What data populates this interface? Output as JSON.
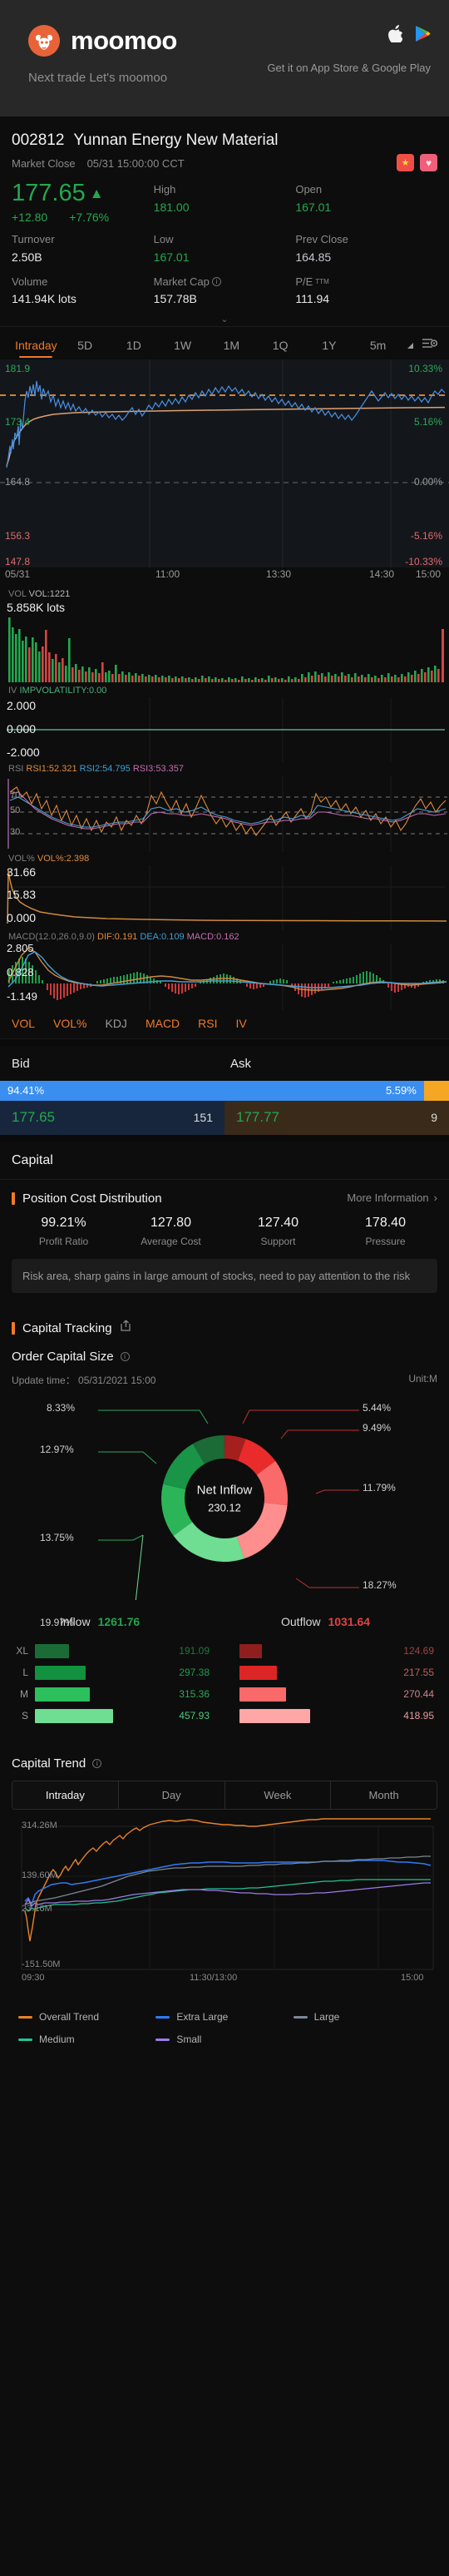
{
  "promo": {
    "wordmark": "moomoo",
    "tagline": "Next trade Let's moomoo",
    "store_caption": "Get it on App Store & Google Play",
    "apple_icon": "apple-icon",
    "google_play_icon": "google-play-icon"
  },
  "quote": {
    "symbol": "002812",
    "name": "Yunnan Energy New Material",
    "market_status": "Market Close",
    "timestamp": "05/31 15:00:00 CCT",
    "flag_badge": "cn-flag-icon",
    "watch_badge": "heart-icon",
    "last_price": "177.65",
    "arrow": "▲",
    "change": "+12.80",
    "change_pct": "+7.76%",
    "stats": [
      {
        "label": "Turnover",
        "value": "2.50B",
        "tone": "plain"
      },
      {
        "label": "High",
        "value": "181.00",
        "tone": "up"
      },
      {
        "label": "Open",
        "value": "167.01",
        "tone": "up"
      },
      {
        "label": "Low",
        "value": "167.01",
        "tone": "up"
      },
      {
        "label": "Prev Close",
        "value": "164.85",
        "tone": "neutral"
      },
      {
        "label": "Volume",
        "value": "141.94K lots",
        "tone": "plain"
      },
      {
        "label": "Market Cap",
        "value": "157.78B",
        "tone": "plain"
      },
      {
        "label": "P/E",
        "value": "111.94",
        "tone": "plain"
      }
    ],
    "expand_icon": "chevron-down-icon"
  },
  "timeframes": {
    "tabs": [
      "Intraday",
      "5D",
      "1D",
      "1W",
      "1M",
      "1Q",
      "1Y",
      "5m"
    ],
    "active": "Intraday",
    "settings_icon": "chart-settings-icon",
    "expand_icon": "triangle-expand-icon"
  },
  "price_chart": {
    "y_top": "181.9",
    "y_upper": "173.4",
    "y_mid": "164.8",
    "y_lower": "156.3",
    "y_bottom": "147.8",
    "p_top": "10.33%",
    "p_upper": "5.16%",
    "p_mid": "0.00%",
    "p_lower": "-5.16%",
    "p_bottom": "-10.33%",
    "x_ticks": [
      "05/31",
      "11:00",
      "13:30",
      "14:30",
      "15:00"
    ]
  },
  "indicators": {
    "vol": {
      "name": "VOL",
      "reading": "VOL:1221",
      "peak": "5.858K lots"
    },
    "iv": {
      "name": "IV",
      "reading": "IMPVOLATILITY:0.00",
      "y": [
        "2.000",
        "0.000",
        "-2.000"
      ]
    },
    "rsi": {
      "name": "RSI",
      "r1": "RSI1:52.321",
      "r2": "RSI2:54.795",
      "r3": "RSI3:53.357",
      "levels": [
        "70",
        "50",
        "30"
      ]
    },
    "volpct": {
      "name": "VOL%",
      "reading": "VOL%:2.398",
      "y": [
        "31.66",
        "15.83",
        "0.000"
      ]
    },
    "macd": {
      "name": "MACD(12.0,26.0,9.0)",
      "dif": "DIF:0.191",
      "dea": "DEA:0.109",
      "macd": "MACD:0.162",
      "y": [
        "2.805",
        "0.828",
        "-1.149"
      ]
    },
    "tabs": [
      "VOL",
      "VOL%",
      "KDJ",
      "MACD",
      "RSI",
      "IV"
    ],
    "inactive_tab": "KDJ"
  },
  "order_book": {
    "bid_label": "Bid",
    "ask_label": "Ask",
    "bid_pct": "94.41%",
    "ask_pct": "5.59%",
    "bid_price": "177.65",
    "bid_qty": "151",
    "ask_price": "177.77",
    "ask_qty": "9"
  },
  "capital": {
    "section_title": "Capital",
    "pcd": {
      "title": "Position Cost Distribution",
      "more": "More Information",
      "more_icon": "chevron-right-icon",
      "metrics": [
        {
          "value": "99.21%",
          "label": "Profit Ratio"
        },
        {
          "value": "127.80",
          "label": "Average Cost"
        },
        {
          "value": "127.40",
          "label": "Support"
        },
        {
          "value": "178.40",
          "label": "Pressure"
        }
      ],
      "note": "Risk area, sharp gains in large amount of stocks, need to pay attention to the risk"
    },
    "tracking": {
      "title": "Capital Tracking",
      "share_icon": "share-icon",
      "order_size_title": "Order Capital Size",
      "info_icon": "info-icon",
      "update_time": "Update time： 05/31/2021 15:00",
      "unit": "Unit:M"
    }
  },
  "chart_data": [
    {
      "type": "pie",
      "title": "Net Inflow",
      "center_value": "230.12",
      "labels": [
        "8.33%",
        "12.97%",
        "13.75%",
        "19.97%",
        "18.27%",
        "11.79%",
        "9.49%",
        "5.44%"
      ],
      "slices": [
        {
          "label": "8.33%",
          "value": 8.33,
          "color": "#1b6b36"
        },
        {
          "label": "12.97%",
          "value": 12.97,
          "color": "#1a9447"
        },
        {
          "label": "13.75%",
          "value": 13.75,
          "color": "#2cb558"
        },
        {
          "label": "19.97%",
          "value": 19.97,
          "color": "#6fdd92"
        },
        {
          "label": "18.27%",
          "value": 18.27,
          "color": "#ff8e8e"
        },
        {
          "label": "11.79%",
          "value": 11.79,
          "color": "#fb6a6a"
        },
        {
          "label": "9.49%",
          "value": 9.49,
          "color": "#ea2b2b"
        },
        {
          "label": "5.44%",
          "value": 5.44,
          "color": "#a51f1f"
        }
      ]
    },
    {
      "type": "bar",
      "title": "Inflow / Outflow",
      "categories": [
        "XL",
        "L",
        "M",
        "S"
      ],
      "inflow_label": "Inflow",
      "inflow_total": "1261.76",
      "outflow_label": "Outflow",
      "outflow_total": "1031.64",
      "series": [
        {
          "name": "Inflow",
          "values": [
            191.09,
            297.38,
            315.36,
            457.93
          ],
          "display": [
            "191.09",
            "297.38",
            "315.36",
            "457.93"
          ],
          "colors": [
            "#1b6b36",
            "#12913f",
            "#2cc05c",
            "#6fdd92"
          ]
        },
        {
          "name": "Outflow",
          "values": [
            124.69,
            217.55,
            270.44,
            418.95
          ],
          "display": [
            "124.69",
            "217.55",
            "270.44",
            "418.95"
          ],
          "colors": [
            "#8f1f1f",
            "#dc2626",
            "#fb6a6a",
            "#ffa6a6"
          ]
        }
      ]
    },
    {
      "type": "line",
      "title": "Capital Trend",
      "info_icon": "info-icon",
      "tabs": [
        "Intraday",
        "Day",
        "Week",
        "Month"
      ],
      "active_tab": "Intraday",
      "ylim": [
        -151.5,
        314.26
      ],
      "y_ticks": [
        "314.26M",
        "139.60M",
        "23.16M",
        "-151.50M"
      ],
      "x_ticks": [
        "09:30",
        "11:30/13:00",
        "15:00"
      ],
      "legend": [
        {
          "name": "Overall Trend",
          "color": "#e8832a"
        },
        {
          "name": "Extra Large",
          "color": "#2f7bf5"
        },
        {
          "name": "Large",
          "color": "#7d8794"
        },
        {
          "name": "Medium",
          "color": "#25c296"
        },
        {
          "name": "Small",
          "color": "#9b7ce8"
        }
      ]
    }
  ]
}
